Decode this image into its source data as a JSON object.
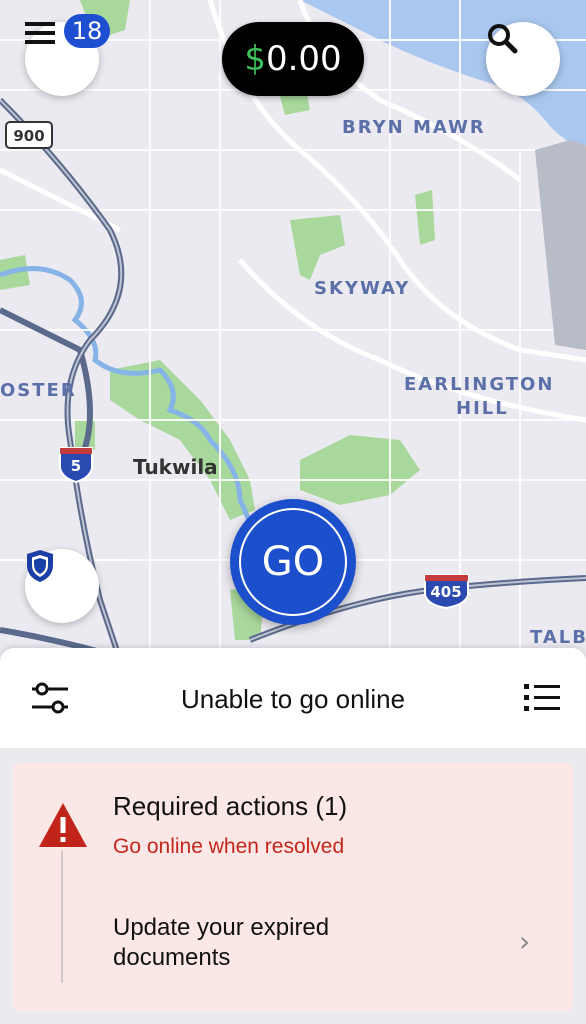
{
  "colors": {
    "accent": "#1b4fcc",
    "earnings_currency": "#3fbe5b",
    "alert_text": "#c4271b",
    "alert_bg": "#fbe8e6",
    "warning_icon": "#c0241b"
  },
  "map": {
    "labels": {
      "bryn_mawr": "BRYN MAWR",
      "skyway": "SKYWAY",
      "earlington_1": "EARLINGTON",
      "earlington_2": "HILL",
      "foster": "OSTER",
      "talb": "TALB",
      "tukwila": "Tukwila"
    },
    "shields": {
      "i5": "5",
      "i405": "405",
      "sr900": "900"
    }
  },
  "header": {
    "menu_icon": "hamburger-menu-icon",
    "notification_count": "18",
    "earnings_currency": "$",
    "earnings_amount": "0.00",
    "search_icon": "search-icon"
  },
  "safety_icon": "shield-icon",
  "go_button_label": "GO",
  "status": {
    "title": "Unable to go online",
    "filter_icon": "sliders-icon",
    "list_icon": "list-icon"
  },
  "required_actions": {
    "title": "Required actions (1)",
    "subtitle": "Go online when resolved",
    "warning_icon": "warning-triangle-icon",
    "item_line1": "Update your expired",
    "item_line2": "documents",
    "chevron": "›"
  }
}
